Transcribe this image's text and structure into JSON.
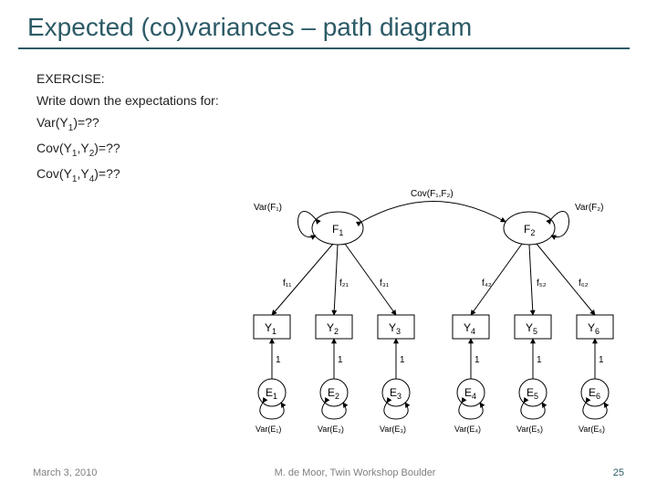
{
  "title": "Expected (co)variances – path diagram",
  "exercise_label": "EXERCISE:",
  "prompt": "Write down the expectations for:",
  "q1_a": "Var(Y",
  "q1_s": "1",
  "q1_b": ")=??",
  "q2_a": "Cov(Y",
  "q2_s1": "1",
  "q2_m": ",Y",
  "q2_s2": "2",
  "q2_b": ")=??",
  "q3_a": "Cov(Y",
  "q3_s1": "1",
  "q3_m": ",Y",
  "q3_s2": "4",
  "q3_b": ")=??",
  "diagram": {
    "F1": "F",
    "F1_sub": "1",
    "F2": "F",
    "F2_sub": "2",
    "varF1": "Var(F₁)",
    "varF2": "Var(F₂)",
    "covF": "Cov(F₁,F₂)",
    "loadings": [
      "f₁₁",
      "f₂₁",
      "f₃₁",
      "f₄₂",
      "f₅₂",
      "f₆₂"
    ],
    "Y": [
      "Y",
      "Y",
      "Y",
      "Y",
      "Y",
      "Y"
    ],
    "Y_sub": [
      "1",
      "2",
      "3",
      "4",
      "5",
      "6"
    ],
    "ones": [
      "1",
      "1",
      "1",
      "1",
      "1",
      "1"
    ],
    "E": [
      "E",
      "E",
      "E",
      "E",
      "E",
      "E"
    ],
    "E_sub": [
      "1",
      "2",
      "3",
      "4",
      "5",
      "6"
    ],
    "varE": [
      "Var(E₁)",
      "Var(E₂)",
      "Var(E₃)",
      "Var(E₄)",
      "Var(E₅)",
      "Var(E₆)"
    ]
  },
  "footer": {
    "date": "March 3, 2010",
    "center": "M. de Moor, Twin Workshop Boulder",
    "page": "25"
  }
}
